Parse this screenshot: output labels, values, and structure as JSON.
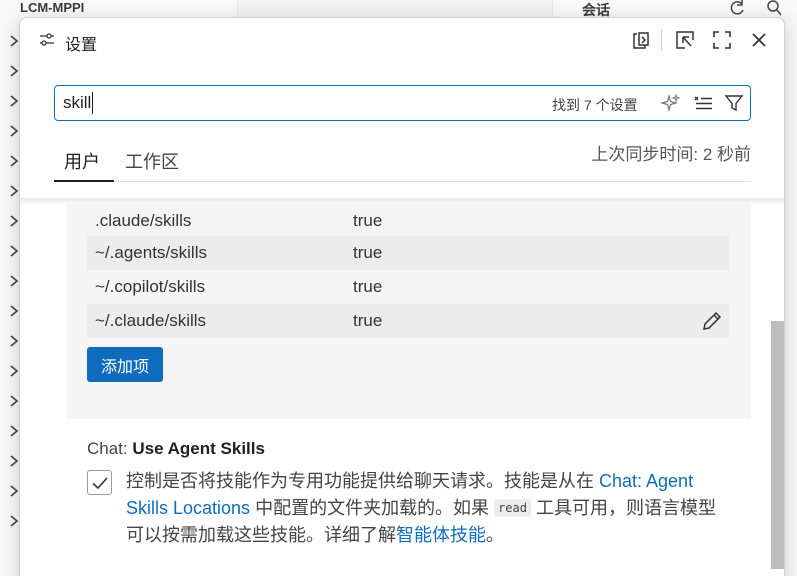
{
  "background": {
    "explorer_title": "LCM-MPPI",
    "right_panel_title": "会话"
  },
  "dialog": {
    "title": "设置",
    "toolbar": {
      "icons": [
        "settings-icon",
        "open-json-icon",
        "dock-icon",
        "maximize-icon",
        "close-icon"
      ]
    },
    "search": {
      "value": "skill",
      "result_count": "找到 7 个设置",
      "icons": [
        "sparkle-icon",
        "clear-filter-icon",
        "filter-icon"
      ]
    },
    "tabs": [
      {
        "label": "用户",
        "active": true
      },
      {
        "label": "工作区",
        "active": false
      }
    ],
    "sync_status": "上次同步时间: 2 秒前",
    "locations_list": {
      "rows": [
        {
          "key": ".claude/skills",
          "value": "true"
        },
        {
          "key": "~/.agents/skills",
          "value": "true"
        },
        {
          "key": "~/.copilot/skills",
          "value": "true"
        },
        {
          "key": "~/.claude/skills",
          "value": "true"
        }
      ],
      "add_button": "添加项"
    },
    "use_agent_skills": {
      "category": "Chat: ",
      "title": "Use Agent Skills",
      "checked": true,
      "desc_1": "控制是否将技能作为专用功能提供给聊天请求。技能是从在 ",
      "link_1": "Chat: Agent Skills Locations",
      "desc_2": " 中配置的文件夹加载的。如果 ",
      "code": "read",
      "desc_3": " 工具可用，则语言模型可以按需加载这些技能。详细了解",
      "link_2": "智能体技能",
      "desc_4": "。"
    }
  },
  "colors": {
    "accent": "#0f6cbd",
    "text": "#1f1f1f"
  }
}
